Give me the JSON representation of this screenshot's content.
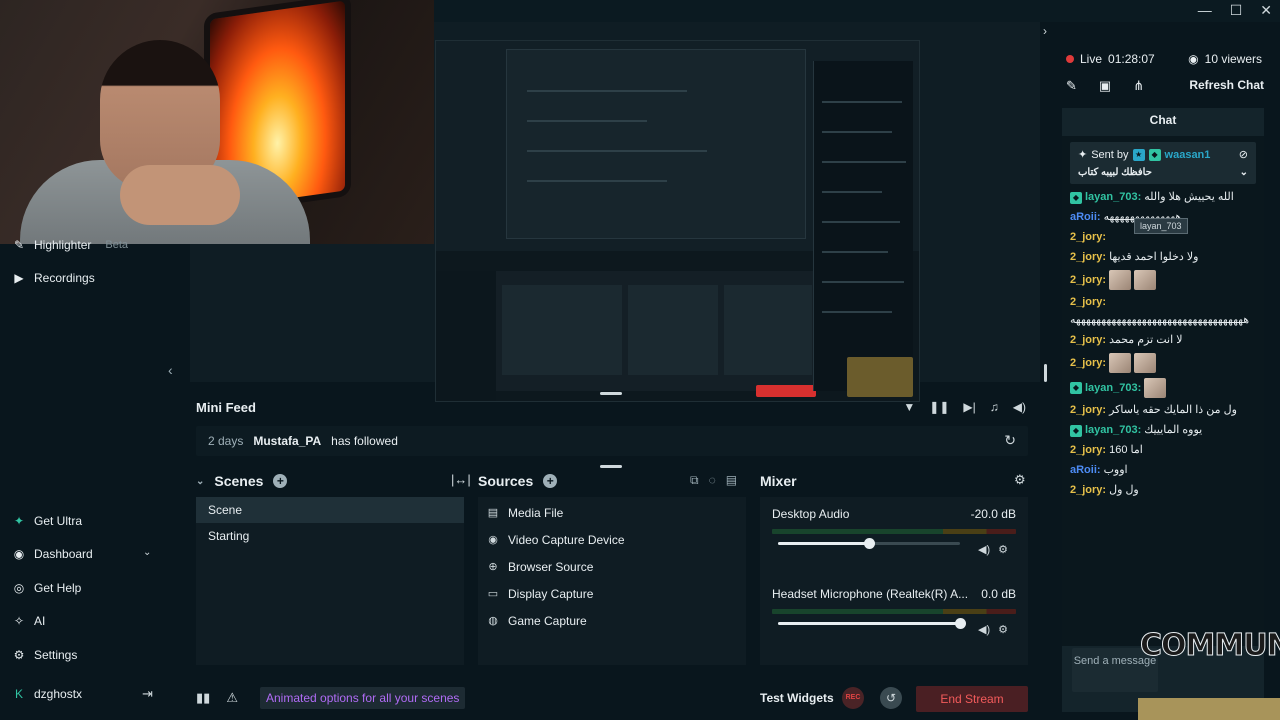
{
  "window": {
    "min": "—",
    "max": "☐",
    "close": "✕"
  },
  "sidebar": {
    "top_items": [
      {
        "label": "Highlighter",
        "badge": "Beta",
        "icon": "highlighter-icon"
      },
      {
        "label": "Recordings",
        "icon": "recordings-icon"
      }
    ],
    "bottom_items": [
      {
        "label": "Get Ultra",
        "icon": "ultra-icon"
      },
      {
        "label": "Dashboard",
        "icon": "dashboard-icon",
        "chevron": "⌄"
      },
      {
        "label": "Get Help",
        "icon": "help-icon"
      },
      {
        "label": "AI",
        "icon": "ai-icon"
      },
      {
        "label": "Settings",
        "icon": "settings-icon"
      }
    ],
    "user": "dzghostx"
  },
  "minifeed": {
    "title": "Mini Feed",
    "event": {
      "time": "2 days",
      "user": "Mustafa_PA",
      "action": "has followed"
    }
  },
  "scenes": {
    "title": "Scenes",
    "items": [
      "Scene",
      "Starting"
    ],
    "active_index": 0
  },
  "sources": {
    "title": "Sources",
    "items": [
      {
        "label": "Media File",
        "icon": "media-file-icon"
      },
      {
        "label": "Video Capture Device",
        "icon": "webcam-icon"
      },
      {
        "label": "Browser Source",
        "icon": "globe-icon"
      },
      {
        "label": "Display Capture",
        "icon": "monitor-icon"
      },
      {
        "label": "Game Capture",
        "icon": "gamepad-icon"
      }
    ]
  },
  "mixer": {
    "title": "Mixer",
    "channels": [
      {
        "name": "Desktop Audio",
        "level": "-20.0 dB",
        "volume": 0.5
      },
      {
        "name": "Headset Microphone (Realtek(R) A...",
        "level": "0.0 dB",
        "volume": 1.0
      }
    ]
  },
  "footer": {
    "animated_options": "Animated options for all your scenes",
    "test_widgets": "Test Widgets",
    "rec": "REC",
    "end_stream": "End Stream"
  },
  "chat_panel": {
    "live_label": "Live",
    "live_time": "01:28:07",
    "viewers": "10 viewers",
    "refresh": "Refresh Chat",
    "chat_title": "Chat",
    "pinned": {
      "sent_by": "Sent by",
      "user": "waasan1",
      "text": "حافظك لبيبه كتاب"
    },
    "messages": [
      {
        "user": "layan_703",
        "color": "#31c3a2",
        "text": "الله يحييش هلا والله",
        "badge": true
      },
      {
        "user": "aRoii",
        "color": "#4d8cf5",
        "text": "ههههههههههههههه"
      },
      {
        "user": "2_jory",
        "color": "#e7c14a",
        "text": ""
      },
      {
        "user": "2_jory",
        "color": "#e7c14a",
        "text": "ولا دخلوا احمد قديها"
      },
      {
        "user": "2_jory",
        "color": "#e7c14a",
        "text": "",
        "emotes": 2
      },
      {
        "user": "2_jory",
        "color": "#e7c14a",
        "text": "ههههههههههههههههههههههههههههههههههه"
      },
      {
        "user": "2_jory",
        "color": "#e7c14a",
        "text": "لا انت تزم محمد"
      },
      {
        "user": "2_jory",
        "color": "#e7c14a",
        "text": "",
        "emotes": 2
      },
      {
        "user": "layan_703",
        "color": "#31c3a2",
        "text": "",
        "badge": true,
        "emotes": 1
      },
      {
        "user": "2_jory",
        "color": "#e7c14a",
        "text": "ول من ذا المايك حقه ياساكر"
      },
      {
        "user": "layan_703",
        "color": "#31c3a2",
        "text": "يووه المايييك",
        "badge": true
      },
      {
        "user": "2_jory",
        "color": "#e7c14a",
        "text": "اما 160"
      },
      {
        "user": "aRoii",
        "color": "#4d8cf5",
        "text": "اووب"
      },
      {
        "user": "2_jory",
        "color": "#e7c14a",
        "text": "ول ول"
      }
    ],
    "tooltip": "layan_703",
    "send_placeholder": "Send a message"
  },
  "overlay": {
    "logo_text": "COMMUNITY"
  }
}
